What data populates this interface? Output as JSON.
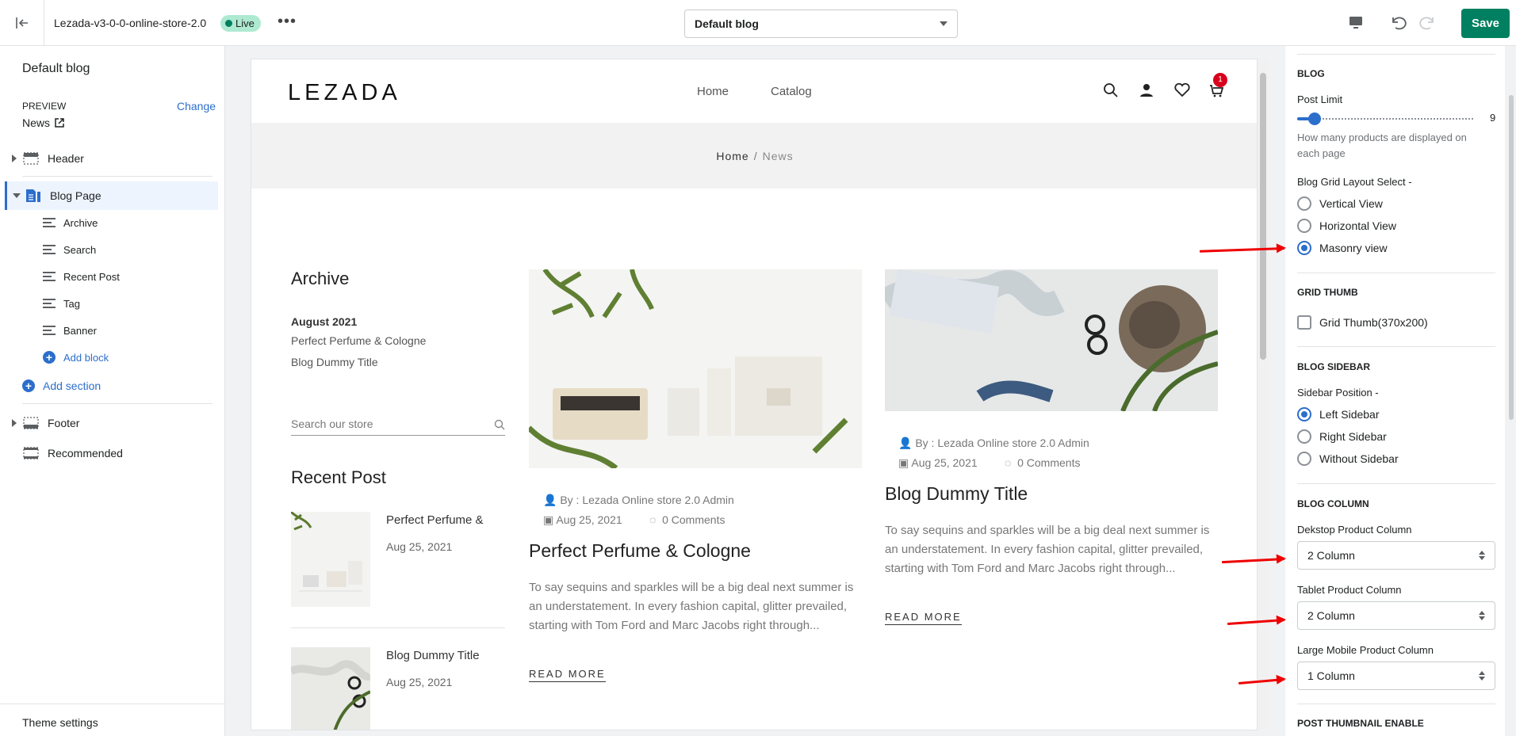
{
  "topbar": {
    "store_name": "Lezada-v3-0-0-online-store-2.0",
    "status": "Live",
    "more": "•••",
    "template_value": "Default blog",
    "save_label": "Save"
  },
  "sidebar": {
    "title": "Default blog",
    "preview_label": "PREVIEW",
    "change_label": "Change",
    "preview_value": "News",
    "header_label": "Header",
    "blog_page_label": "Blog Page",
    "blocks": [
      "Archive",
      "Search",
      "Recent Post",
      "Tag",
      "Banner"
    ],
    "add_block": "Add block",
    "add_section": "Add section",
    "footer_label": "Footer",
    "recommended_label": "Recommended",
    "theme_settings": "Theme settings"
  },
  "preview": {
    "logo": "LEZADA",
    "nav": [
      "Home",
      "Catalog"
    ],
    "cart_count": "1",
    "breadcrumb_home": "Home",
    "breadcrumb_sep": "/",
    "breadcrumb_current": "News",
    "archive_title": "Archive",
    "archive_month": "August 2021",
    "archive_links": [
      "Perfect Perfume & Cologne",
      "Blog Dummy Title"
    ],
    "search_placeholder": "Search our store",
    "recent_title": "Recent Post",
    "recent_posts": [
      {
        "title": "Perfect Perfume &",
        "date": "Aug 25, 2021"
      },
      {
        "title": "Blog Dummy Title",
        "date": "Aug 25, 2021"
      }
    ],
    "posts": [
      {
        "author": "By : Lezada Online store 2.0 Admin",
        "date": "Aug 25, 2021",
        "comments": "0 Comments",
        "title": "Perfect Perfume & Cologne",
        "excerpt": "To say sequins and sparkles will be a big deal next summer is an understatement. In every fashion capital, glitter prevailed, starting with Tom Ford and Marc Jacobs right through...",
        "read_more": "READ MORE"
      },
      {
        "author": "By : Lezada Online store 2.0 Admin",
        "date": "Aug 25, 2021",
        "comments": "0 Comments",
        "title": "Blog Dummy Title",
        "excerpt": "To say sequins and sparkles will be a big deal next summer is an understatement. In every fashion capital, glitter prevailed, starting with Tom Ford and Marc Jacobs right through...",
        "read_more": "READ MORE"
      }
    ]
  },
  "settings": {
    "blog_heading": "BLOG",
    "post_limit_label": "Post Limit",
    "post_limit_value": "9",
    "post_limit_help": "How many products are displayed on each page",
    "layout_label": "Blog Grid Layout Select -",
    "layout_options": [
      "Vertical View",
      "Horizontal View",
      "Masonry view"
    ],
    "grid_thumb_heading": "GRID THUMB",
    "grid_thumb_label": "Grid Thumb(370x200)",
    "sidebar_heading": "BLOG SIDEBAR",
    "sidebar_position_label": "Sidebar Position -",
    "sidebar_options": [
      "Left Sidebar",
      "Right Sidebar",
      "Without Sidebar"
    ],
    "column_heading": "BLOG COLUMN",
    "desktop_label": "Dekstop Product Column",
    "desktop_value": "2 Column",
    "tablet_label": "Tablet Product Column",
    "tablet_value": "2 Column",
    "mobile_label": "Large Mobile Product Column",
    "mobile_value": "1 Column",
    "thumbnail_heading": "POST THUMBNAIL ENABLE"
  },
  "colors": {
    "accent": "#2c6ecb",
    "save": "#008060",
    "live": "#aee9d1",
    "annotation_arrow": "#ee0000"
  }
}
